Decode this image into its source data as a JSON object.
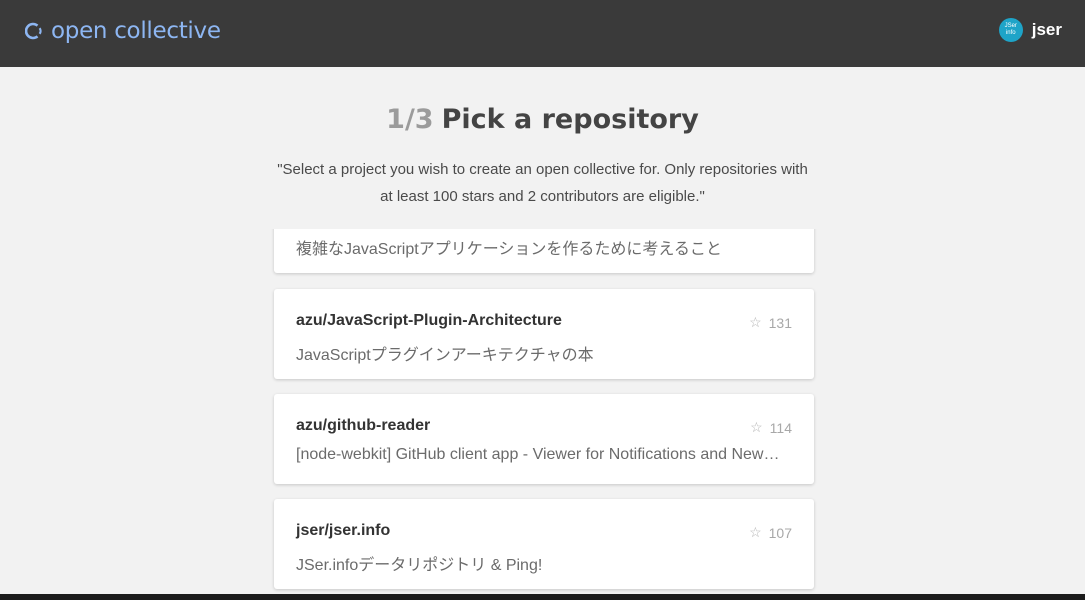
{
  "header": {
    "logo_text": "open collective",
    "user": {
      "name": "jser",
      "avatar_text_line1": "JSer",
      "avatar_text_line2": "info"
    }
  },
  "page": {
    "step": "1/3",
    "title": "Pick a repository",
    "subtitle": "\"Select a project you wish to create an open collective for. Only repositories with at least 100 stars and 2 contributors are eligible.\""
  },
  "repositories": [
    {
      "name": "",
      "description": "複雑なJavaScriptアプリケーションを作るために考えること",
      "stars": ""
    },
    {
      "name": "azu/JavaScript-Plugin-Architecture",
      "description": "JavaScriptプラグインアーキテクチャの本",
      "stars": "131"
    },
    {
      "name": "azu/github-reader",
      "description": "[node-webkit] GitHub client app - Viewer for Notifications and News ...",
      "stars": "114"
    },
    {
      "name": "jser/jser.info",
      "description": "JSer.infoデータリポジトリ & Ping!",
      "stars": "107"
    }
  ],
  "icons": {
    "star": "star-outline-icon",
    "logo": "open-collective-logo-icon"
  },
  "colors": {
    "topbar": "#3a3a3a",
    "logo": "#8db6f2",
    "background": "#f2f2f2",
    "avatar": "#1ea4c8"
  }
}
